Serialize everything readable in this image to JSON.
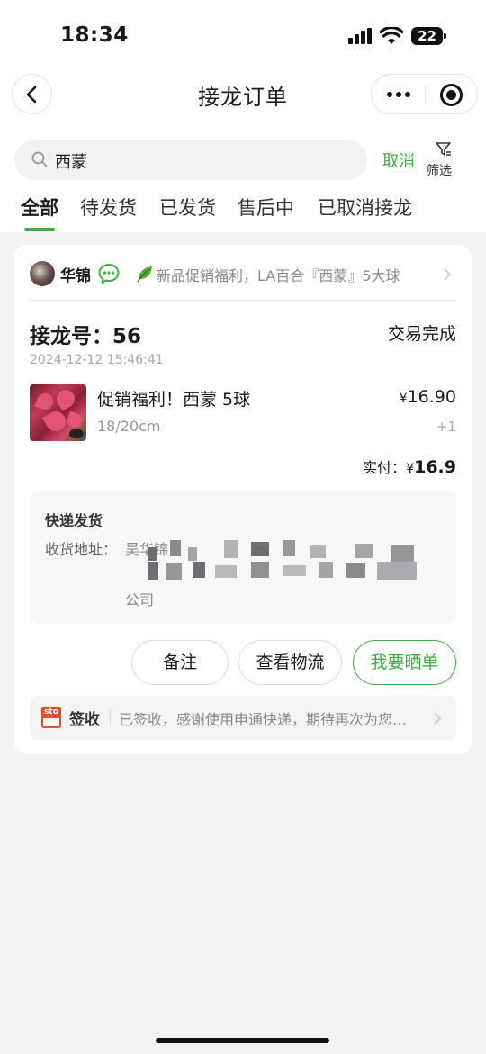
{
  "status_bar": {
    "time": "18:34",
    "battery": "22"
  },
  "nav": {
    "title": "接龙订单"
  },
  "search": {
    "value": "西蒙",
    "cancel_label": "取消",
    "filter_label": "筛选"
  },
  "tabs": [
    {
      "label": "全部",
      "active": true
    },
    {
      "label": "待发货",
      "active": false
    },
    {
      "label": "已发货",
      "active": false
    },
    {
      "label": "售后中",
      "active": false
    },
    {
      "label": "已取消接龙",
      "active": false
    }
  ],
  "order": {
    "seller": "华锦",
    "group_title": "新品促销福利，LA百合『西蒙』5大球",
    "order_label": "接龙号：",
    "order_no": "56",
    "status": "交易完成",
    "datetime": "2024-12-12 15:46:41",
    "product": {
      "name": "促销福利！西蒙 5球",
      "spec": "18/20cm",
      "currency": "¥",
      "price": "16.90",
      "qty": "+1"
    },
    "paid_label": "实付：",
    "paid_currency": "¥",
    "paid_amount": "16.9",
    "shipping": {
      "title": "快递发货",
      "address_label": "收货地址：",
      "address_line1": "吴华锦",
      "address_end": "公司"
    },
    "buttons": {
      "remark": "备注",
      "logistics": "查看物流",
      "share": "我要晒单"
    },
    "tracking": {
      "carrier_logo": "sto",
      "status": "签收",
      "message": "已签收，感谢使用申通快递，期待再次为您服务"
    }
  },
  "colors": {
    "accent": "#3cb043",
    "background": "#f2f3f5",
    "carrier": "#e84b2a"
  }
}
